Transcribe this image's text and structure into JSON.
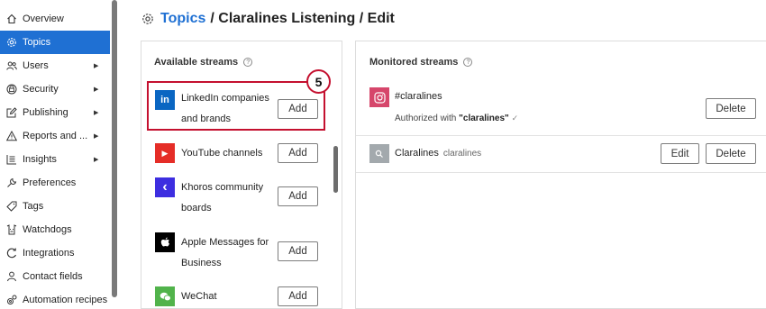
{
  "sidebar": {
    "items": [
      {
        "label": "Overview",
        "icon": "home-icon",
        "chevron": ""
      },
      {
        "label": "Topics",
        "icon": "gear-icon",
        "chevron": "",
        "active": true
      },
      {
        "label": "Users",
        "icon": "users-icon",
        "chevron": "▶"
      },
      {
        "label": "Security",
        "icon": "shield-icon",
        "chevron": "▶"
      },
      {
        "label": "Publishing",
        "icon": "edit-icon",
        "chevron": "▶"
      },
      {
        "label": "Reports and ...",
        "icon": "warning-icon",
        "chevron": "▶"
      },
      {
        "label": "Insights",
        "icon": "chart-icon",
        "chevron": "▶"
      },
      {
        "label": "Preferences",
        "icon": "wrench-icon",
        "chevron": ""
      },
      {
        "label": "Tags",
        "icon": "tag-icon",
        "chevron": ""
      },
      {
        "label": "Watchdogs",
        "icon": "watchdog-icon",
        "chevron": ""
      },
      {
        "label": "Integrations",
        "icon": "refresh-icon",
        "chevron": ""
      },
      {
        "label": "Contact fields",
        "icon": "person-icon",
        "chevron": ""
      },
      {
        "label": "Automation recipes",
        "icon": "automation-icon",
        "chevron": ""
      }
    ]
  },
  "header": {
    "crumb_link": "Topics",
    "crumb_rest": "/ Claralines Listening / Edit"
  },
  "available": {
    "heading": "Available streams",
    "info": "?",
    "step_number": "5",
    "streams": [
      {
        "label": "LinkedIn companies and brands",
        "logo_text": "in",
        "color": "#0a66c2",
        "button": "Add"
      },
      {
        "label": "YouTube channels",
        "logo_text": "▶",
        "color": "#e52d27",
        "button": "Add"
      },
      {
        "label": "Khoros community boards",
        "logo_text": "‹",
        "color": "#3d2ee0",
        "button": "Add"
      },
      {
        "label": "Apple Messages for Business",
        "logo_text": "",
        "color": "#000000",
        "button": "Add"
      },
      {
        "label": "WeChat",
        "logo_text": "",
        "color": "#51b34b",
        "button": "Add"
      }
    ]
  },
  "monitored": {
    "heading": "Monitored streams",
    "info": "?",
    "rows": [
      {
        "name": "#claralines",
        "authorized_prefix": "Authorized with",
        "authorized_account": "\"claralines\"",
        "check": "✓",
        "delete_label": "Delete",
        "color": "#d6466b"
      },
      {
        "name": "Claralines",
        "handle": "claralines",
        "edit_label": "Edit",
        "delete_label": "Delete",
        "color": "#a3a9ad"
      }
    ]
  }
}
